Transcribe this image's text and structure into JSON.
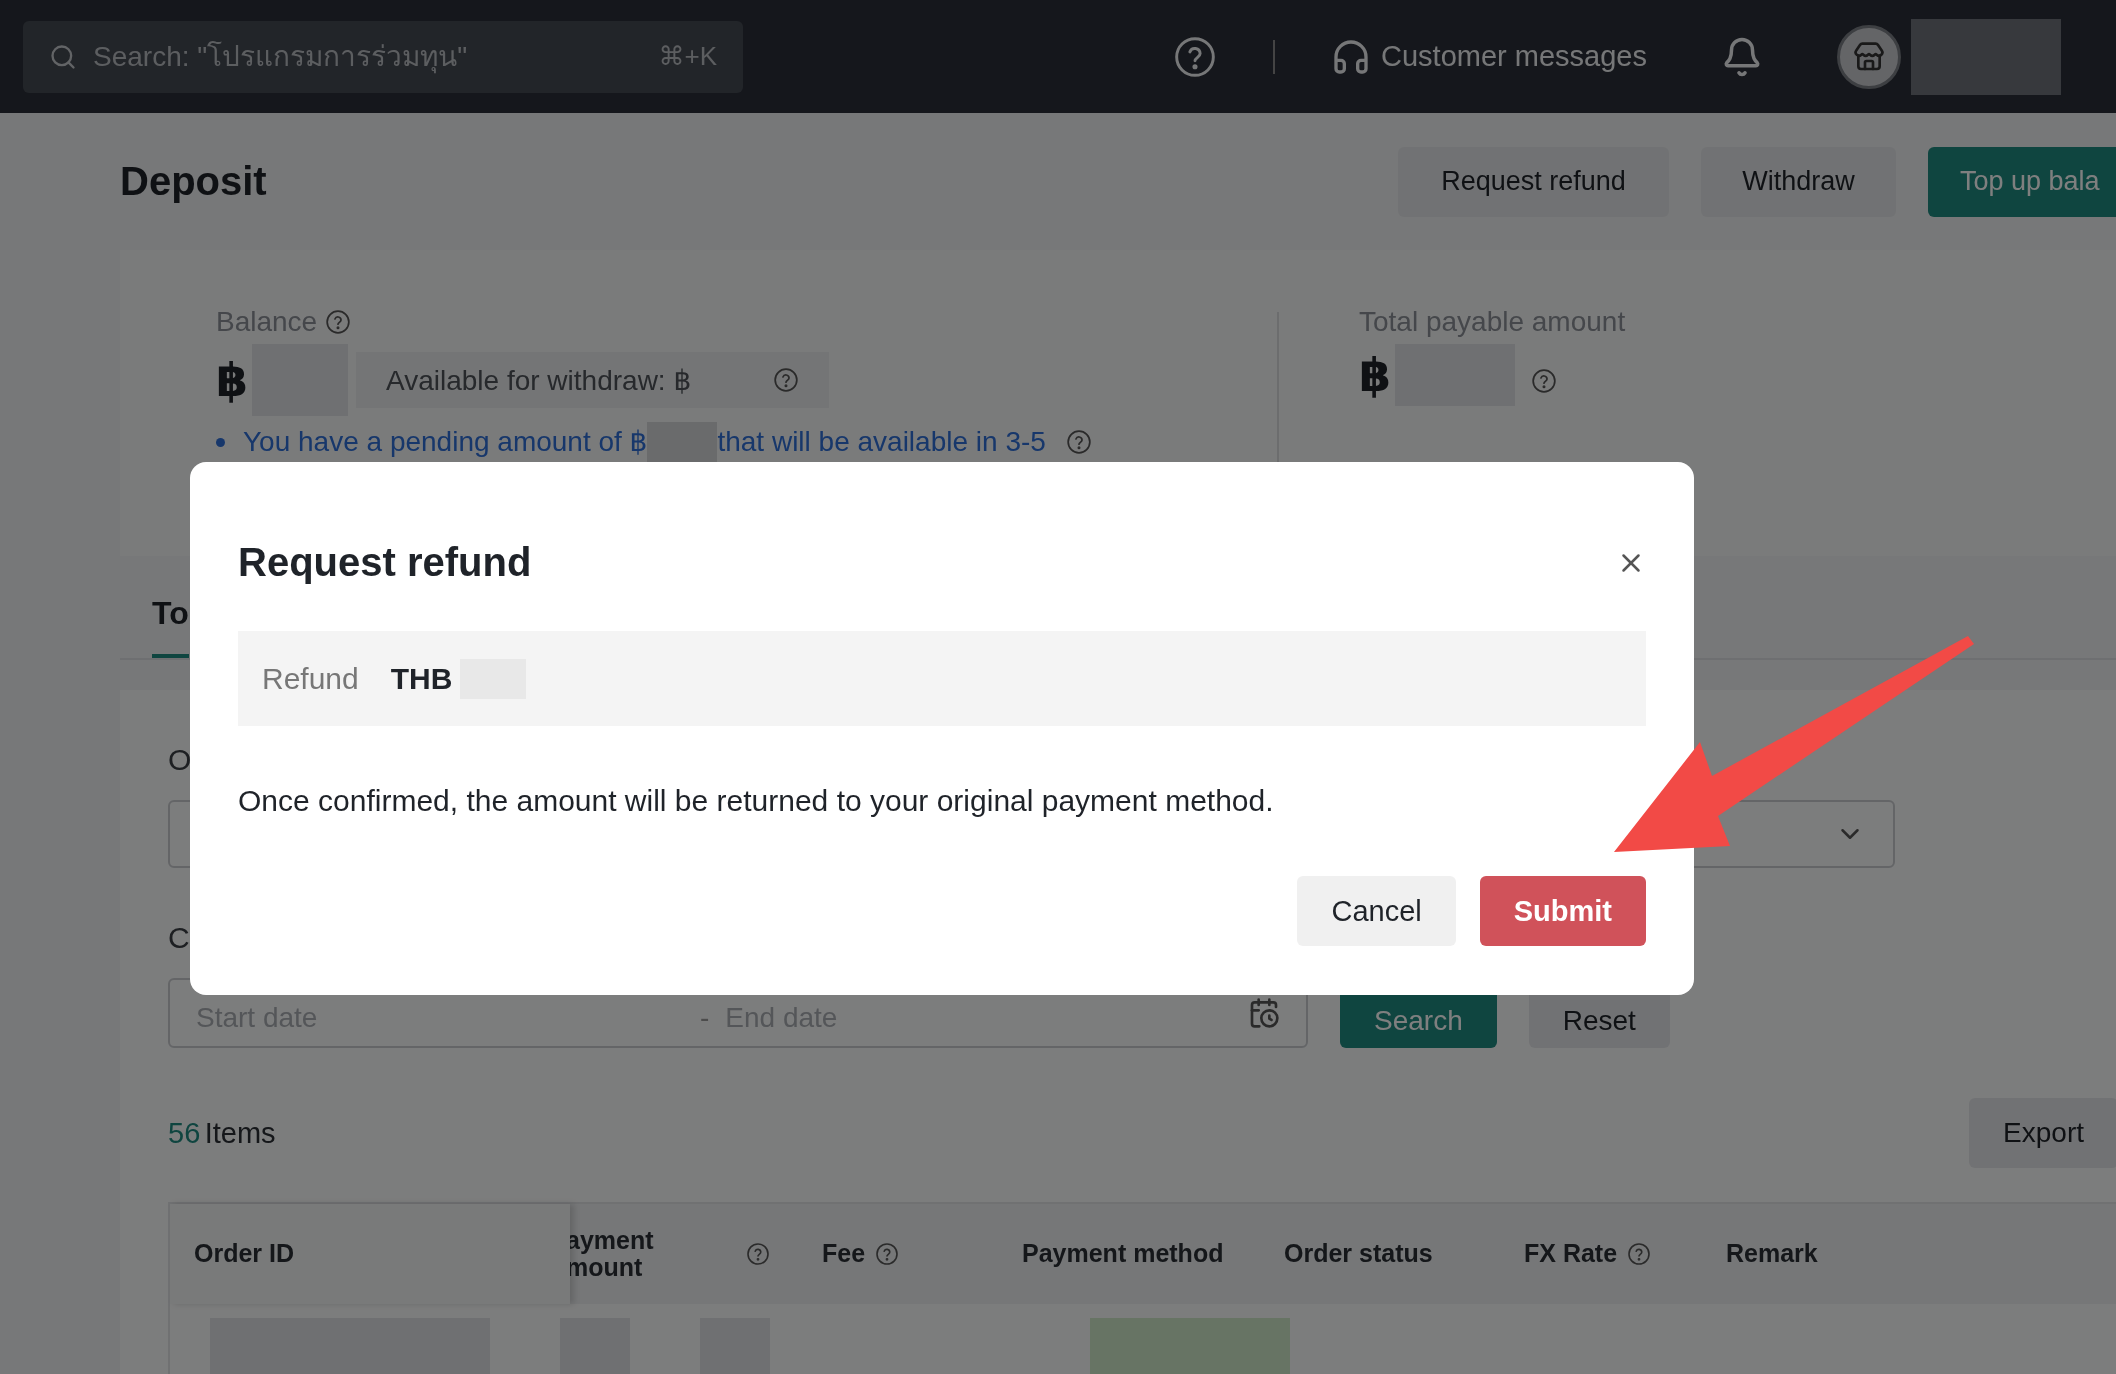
{
  "search": {
    "placeholder": "Search: \"โปรแกรมการร่วมทุน\"",
    "shortcut": "⌘+K"
  },
  "top_bar": {
    "customer_messages": "Customer messages"
  },
  "page": {
    "title": "Deposit",
    "actions": [
      {
        "label": "Request refund",
        "kind": "secondary"
      },
      {
        "label": "Withdraw",
        "kind": "secondary"
      },
      {
        "label": "Top up bala",
        "kind": "primary"
      }
    ]
  },
  "balance": {
    "label": "Balance",
    "currency": "฿",
    "available": "Available for withdraw: ฿",
    "pending_before": "You have a pending amount of ฿",
    "pending_after": "that will be available in 3-5"
  },
  "total": {
    "label": "Total payable amount",
    "currency": "฿"
  },
  "tabs": [
    {
      "label": "To",
      "selected": true
    }
  ],
  "filters": {
    "label_1": "O",
    "label_2": "C",
    "start_placeholder": "Start date",
    "separator": "-",
    "end_placeholder": "End date",
    "search": "Search",
    "reset": "Reset"
  },
  "items": {
    "count": "56",
    "label": "Items",
    "export": "Export"
  },
  "table": {
    "columns": [
      {
        "label": "Order ID",
        "help": false
      },
      {
        "label": "ayment mount",
        "help": true
      },
      {
        "label": "Fee",
        "help": true
      },
      {
        "label": "Payment method",
        "help": false
      },
      {
        "label": "Order status",
        "help": false
      },
      {
        "label": "FX Rate",
        "help": true
      },
      {
        "label": "Remark",
        "help": false
      }
    ]
  },
  "dialog": {
    "title": "Request refund",
    "refund_label": "Refund",
    "currency": "THB",
    "message": "Once confirmed, the amount will be returned to your original payment method.",
    "buttons": [
      {
        "label": "Cancel",
        "kind": "default"
      },
      {
        "label": "Submit",
        "kind": "danger"
      }
    ]
  }
}
